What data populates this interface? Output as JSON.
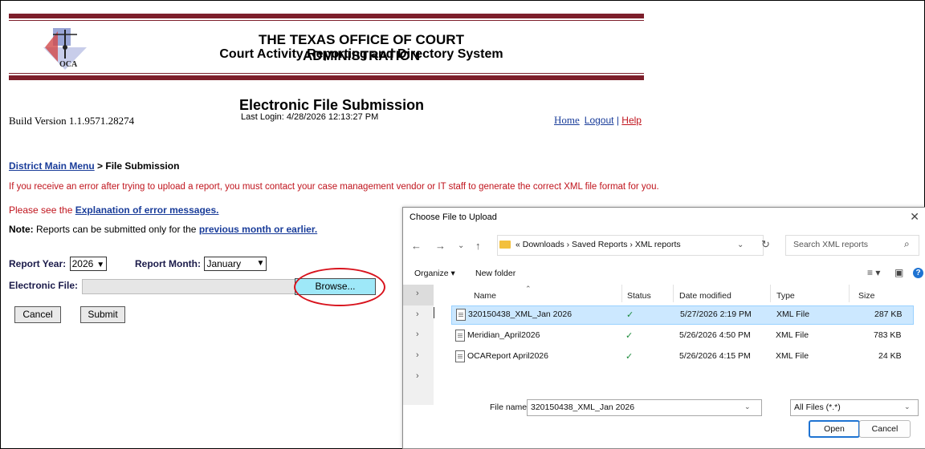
{
  "header": {
    "org_title": "THE TEXAS OFFICE OF COURT ADMINISTRATION",
    "org_subtitle": "Court Activity Reporting and Directory System",
    "logo_text": "OCA"
  },
  "page": {
    "title": "Electronic File Submission",
    "last_login": "Last Login: 4/28/2026 12:13:27 PM",
    "build_version": "Build Version 1.1.9571.28274",
    "links": {
      "home": "Home",
      "logout": "Logout",
      "separator": "|",
      "help": "Help"
    }
  },
  "breadcrumb": {
    "link": "District Main Menu",
    "separator": ">",
    "current": "File Submission"
  },
  "messages": {
    "error_notice": "If you receive an error after trying to upload a report, you must contact your case management vendor or IT staff to generate the correct XML file format for you.",
    "see_prefix": "Please see the",
    "see_link": "Explanation of error messages.",
    "note_label": "Note:",
    "note_text": "Reports can be submitted only for the",
    "note_link": "previous month or earlier."
  },
  "form": {
    "report_year_label": "Report Year:",
    "report_year_value": "2026",
    "report_month_label": "Report Month:",
    "report_month_value": "January",
    "file_label": "Electronic File:",
    "browse_label": "Browse...",
    "cancel_label": "Cancel",
    "submit_label": "Submit"
  },
  "dialog": {
    "title": "Choose File to Upload",
    "breadcrumb": "« Downloads › Saved Reports › XML reports",
    "search_placeholder": "Search XML reports",
    "toolbar": {
      "organize": "Organize ▾",
      "new_folder": "New folder"
    },
    "columns": [
      "Name",
      "Status",
      "Date modified",
      "Type",
      "Size"
    ],
    "files": [
      {
        "name": "320150438_XML_Jan 2026",
        "status": "✓",
        "date": "5/27/2026 2:19 PM",
        "type": "XML File",
        "size": "287 KB"
      },
      {
        "name": "Meridian_April2026",
        "status": "✓",
        "date": "5/26/2026 4:50 PM",
        "type": "XML File",
        "size": "783 KB"
      },
      {
        "name": "OCAReport April2026",
        "status": "✓",
        "date": "5/26/2026 4:15 PM",
        "type": "XML File",
        "size": "24 KB"
      }
    ],
    "file_name_label": "File name:",
    "file_name_value": "320150438_XML_Jan 2026",
    "file_type_value": "All Files (*.*)",
    "open_label": "Open",
    "cancel_label": "Cancel"
  },
  "colors": {
    "header_bar": "#7d1f2b",
    "link": "#1a3d9a",
    "error": "#c0141d",
    "browse_bg": "#9ee8f8",
    "highlight": "#d8131d",
    "selected_row": "#cce8ff"
  }
}
